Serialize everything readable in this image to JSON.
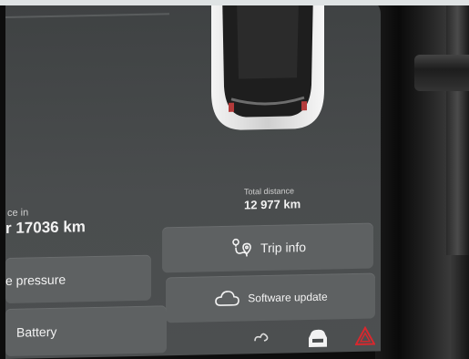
{
  "stats": {
    "service": {
      "label": "ce in",
      "value": "r 17036 km"
    },
    "total_distance": {
      "label": "Total distance",
      "value": "12 977 km"
    }
  },
  "buttons": {
    "tire_pressure": {
      "label": "e pressure",
      "icon": "tire-icon"
    },
    "trip_info": {
      "label": "Trip info",
      "icon": "route-icon"
    },
    "software_update": {
      "label": "Software update",
      "icon": "cloud-icon"
    },
    "battery": {
      "label": "Battery",
      "icon": "battery-icon"
    }
  },
  "bottom_bar": {
    "icons": [
      "fan-icon",
      "car-icon",
      "hazard-icon"
    ]
  },
  "colors": {
    "screen_bg": "#4a4d4e",
    "button_bg": "#5e6162",
    "text": "#f3f3f3",
    "hazard": "#d8282e"
  }
}
